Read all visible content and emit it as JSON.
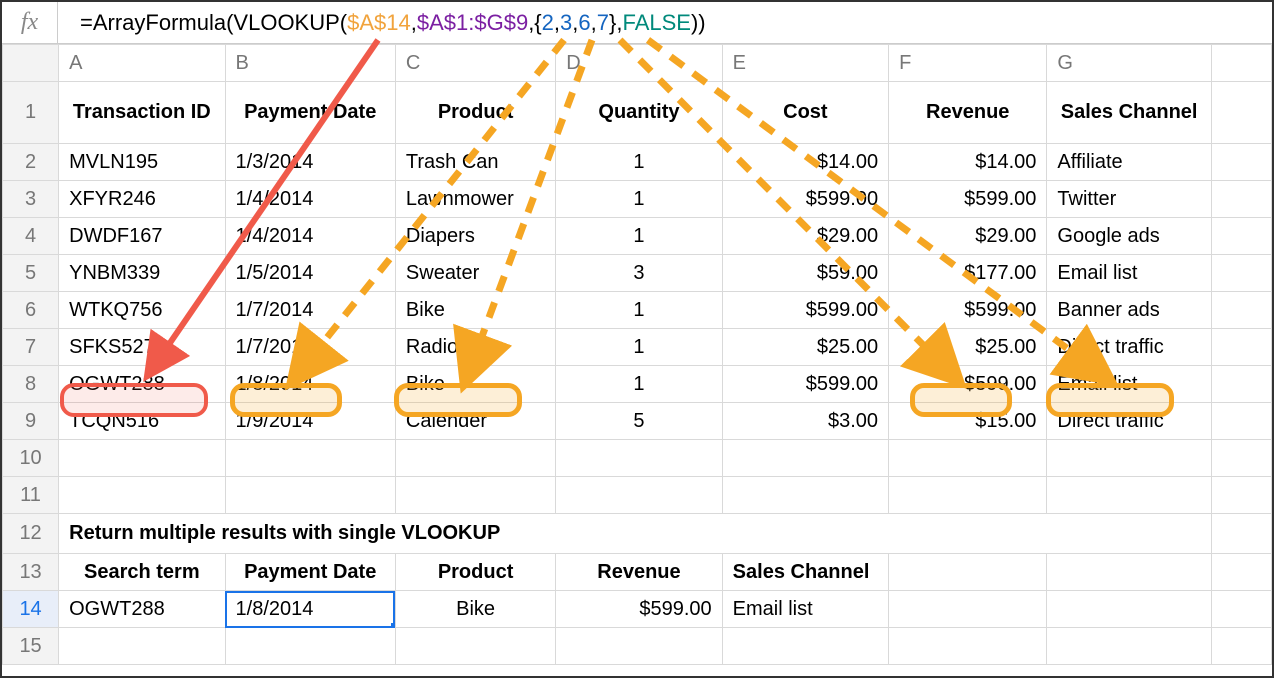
{
  "formula_bar": {
    "fx_label": "fx",
    "tokens": {
      "eq_arrayformula_vlookup_open": "=ArrayFormula(VLOOKUP(",
      "ref_a14": "$A$14",
      "comma1": ",",
      "ref_range": "$A$1:$G$9",
      "comma2": ",{",
      "n2": "2",
      "comma3": ",",
      "n3": "3",
      "comma4": ",",
      "n6": "6",
      "comma5": ",",
      "n7": "7",
      "brace_close_comma": "},",
      "false_tok": "FALSE",
      "close": "))"
    }
  },
  "columns": [
    "A",
    "B",
    "C",
    "D",
    "E",
    "F",
    "G"
  ],
  "row_numbers": [
    "1",
    "2",
    "3",
    "4",
    "5",
    "6",
    "7",
    "8",
    "9",
    "10",
    "11",
    "12",
    "13",
    "14",
    "15"
  ],
  "headers": {
    "A": "Transaction ID",
    "B": "Payment Date",
    "C": "Product",
    "D": "Quantity",
    "E": "Cost",
    "F": "Revenue",
    "G": "Sales Channel"
  },
  "rows": [
    {
      "A": "MVLN195",
      "B": "1/3/2014",
      "C": "Trash Can",
      "D": "1",
      "E": "$14.00",
      "F": "$14.00",
      "G": "Affiliate"
    },
    {
      "A": "XFYR246",
      "B": "1/4/2014",
      "C": "Lawnmower",
      "D": "1",
      "E": "$599.00",
      "F": "$599.00",
      "G": "Twitter"
    },
    {
      "A": "DWDF167",
      "B": "1/4/2014",
      "C": "Diapers",
      "D": "1",
      "E": "$29.00",
      "F": "$29.00",
      "G": "Google ads"
    },
    {
      "A": "YNBM339",
      "B": "1/5/2014",
      "C": "Sweater",
      "D": "3",
      "E": "$59.00",
      "F": "$177.00",
      "G": "Email list"
    },
    {
      "A": "WTKQ756",
      "B": "1/7/2014",
      "C": "Bike",
      "D": "1",
      "E": "$599.00",
      "F": "$599.00",
      "G": "Banner ads"
    },
    {
      "A": "SFKS527",
      "B": "1/7/2014",
      "C": "Radio",
      "D": "1",
      "E": "$25.00",
      "F": "$25.00",
      "G": "Direct traffic"
    },
    {
      "A": "OGWT288",
      "B": "1/8/2014",
      "C": "Bike",
      "D": "1",
      "E": "$599.00",
      "F": "$599.00",
      "G": "Email list"
    },
    {
      "A": "TCQN516",
      "B": "1/9/2014",
      "C": "Calender",
      "D": "5",
      "E": "$3.00",
      "F": "$15.00",
      "G": "Direct traffic"
    }
  ],
  "section_title": "Return multiple results with single VLOOKUP",
  "result_headers": {
    "A": "Search term",
    "B": "Payment Date",
    "C": "Product",
    "D": "Revenue",
    "E": "Sales Channel"
  },
  "result_row": {
    "A": "OGWT288",
    "B": "1/8/2014",
    "C": "Bike",
    "D": "$599.00",
    "E": "Email list"
  },
  "annotations": {
    "red_ring_target": "A8",
    "orange_ring_targets": [
      "B8",
      "C8",
      "F8",
      "G8"
    ]
  }
}
